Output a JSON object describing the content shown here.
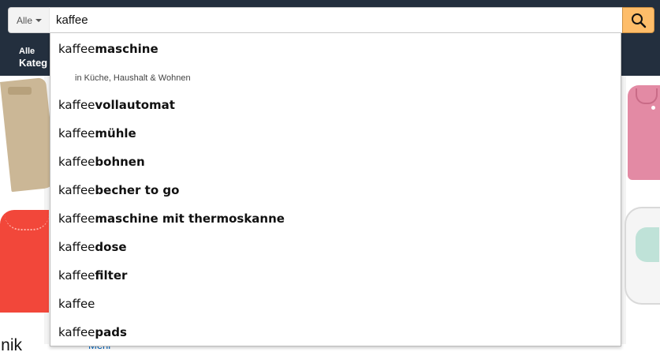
{
  "search": {
    "scope_label": "Alle",
    "query": "kaffee"
  },
  "nav": {
    "all_line1": "Alle",
    "all_line2": "Kateg"
  },
  "suggestions": [
    {
      "prefix": "kaffee",
      "suffix": "maschine"
    },
    {
      "prefix": "kaffee",
      "suffix": "vollautomat"
    },
    {
      "prefix": "kaffee",
      "suffix": "mühle"
    },
    {
      "prefix": "kaffee",
      "suffix": "bohnen"
    },
    {
      "prefix": "kaffee",
      "suffix": "becher to go"
    },
    {
      "prefix": "kaffee",
      "suffix": "maschine mit thermoskanne"
    },
    {
      "prefix": "kaffee",
      "suffix": "dose"
    },
    {
      "prefix": "kaffee",
      "suffix": "filter"
    },
    {
      "prefix": "kaffee",
      "suffix": ""
    },
    {
      "prefix": "kaffee",
      "suffix": "pads"
    }
  ],
  "department_hint": {
    "prefix": "in",
    "department": "Küche, Haushalt & Wohnen"
  },
  "background": {
    "section_title_fragment": "nd Technik",
    "section_link": "Mehr"
  },
  "colors": {
    "header_bg": "#232f3e",
    "search_button": "#febd69",
    "link": "#0066c0"
  },
  "icons": {
    "search_button_icon": "magnifier-icon",
    "scope_caret": "caret-down-icon"
  }
}
